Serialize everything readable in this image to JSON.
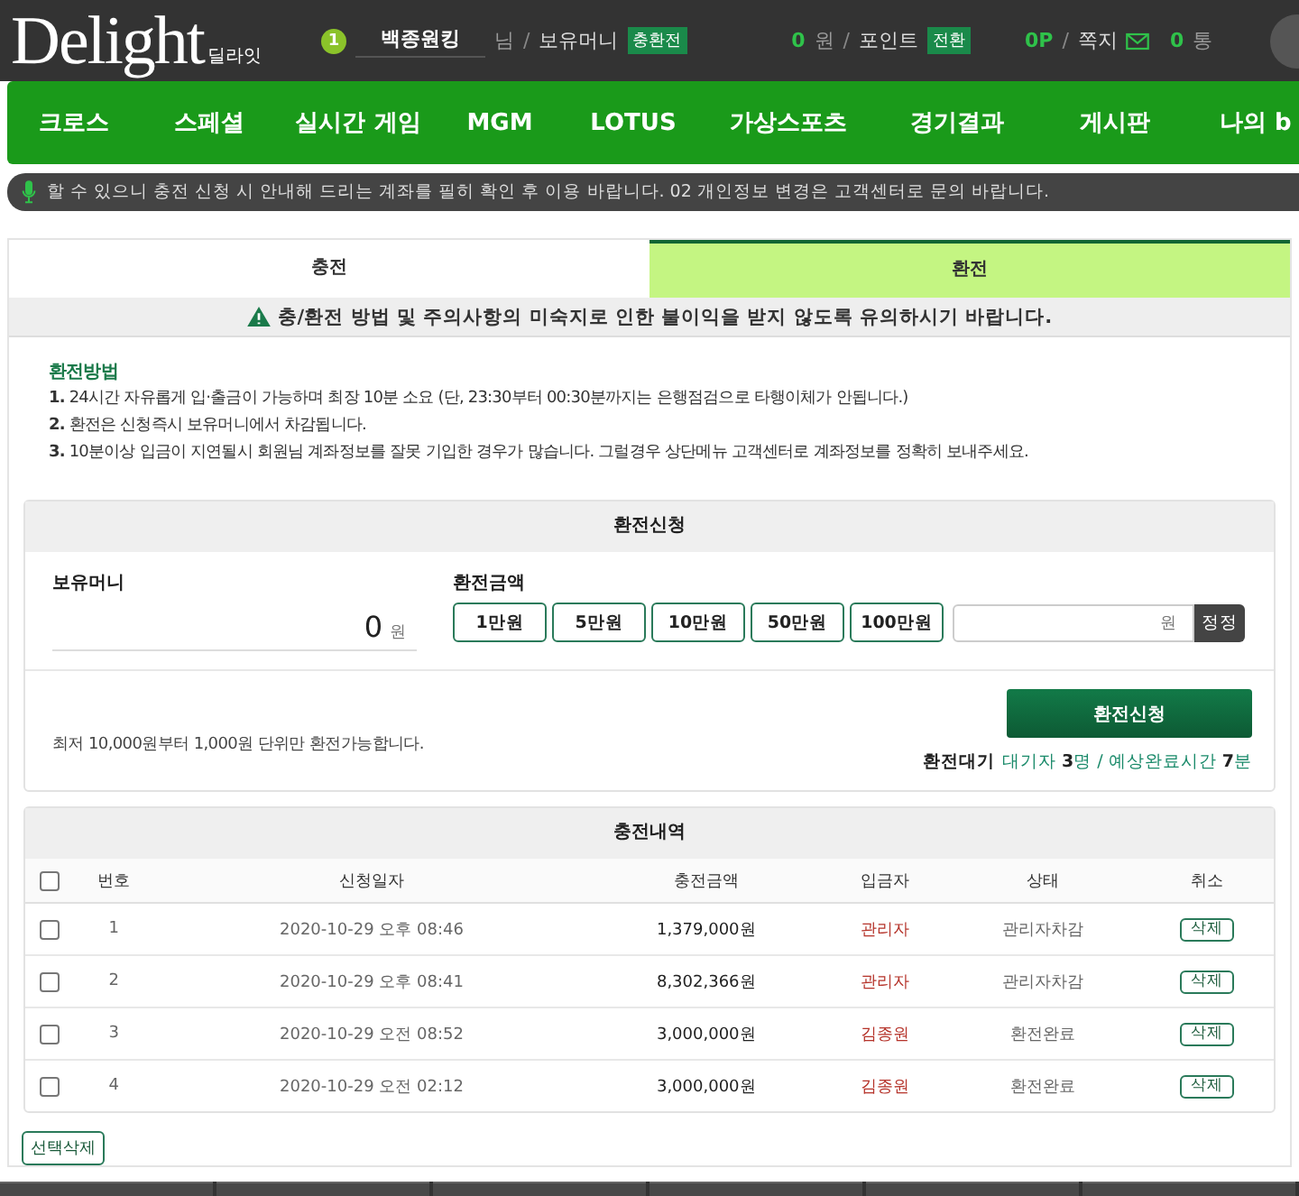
{
  "header": {
    "logo": "Delight",
    "logo_sub": "딜라잇",
    "level": "1",
    "username": "백종원킹",
    "honorific": "님",
    "money_label": "보유머니",
    "money_badge": "충환전",
    "money_value": "0",
    "money_unit": "원",
    "point_label": "포인트",
    "point_badge": "전환",
    "point_value": "0P",
    "message_label": "쪽지",
    "message_count": "0",
    "message_unit": "통",
    "separators": [
      "/",
      "/",
      "/"
    ]
  },
  "nav": [
    "크로스",
    "스페셜",
    "실시간 게임",
    "MGM",
    "LOTUS",
    "가상스포츠",
    "경기결과",
    "게시판",
    "나의 b"
  ],
  "notice": "할 수 있으니 충전 신청 시 안내해 드리는 계좌를 필히 확인 후 이용 바랍니다. 02 개인정보 변경은 고객센터로 문의 바랍니다.",
  "tabs": [
    {
      "label": "충전",
      "selected": false
    },
    {
      "label": "환전",
      "selected": true
    }
  ],
  "warning": "충/환전 방법 및 주의사항의 미숙지로 인한 불이익을 받지 않도록 유의하시기 바랍니다.",
  "method": {
    "title": "환전방법",
    "items": [
      {
        "num": "1.",
        "text": "24시간 자유롭게 입·출금이 가능하며 최장 10분 소요 (단, 23:30부터 00:30분까지는 은행점검으로 타행이체가 안됩니다.)"
      },
      {
        "num": "2.",
        "text": "환전은 신청즉시 보유머니에서 차감됩니다."
      },
      {
        "num": "3.",
        "text": "10분이상 입금이 지연될시 회원님 계좌정보를 잘못 기입한 경우가 많습니다. 그럴경우 상단메뉴 고객센터로 계좌정보를 정확히 보내주세요."
      }
    ]
  },
  "apply": {
    "title": "환전신청",
    "holding_label": "보유머니",
    "holding_value": "0",
    "holding_unit": "원",
    "amount_label": "환전금액",
    "quick_amounts": [
      "1만원",
      "5만원",
      "10만원",
      "50만원",
      "100만원"
    ],
    "amount_unit": "원",
    "reset": "정정",
    "note": "최저 10,000원부터 1,000원 단위만 환전가능합니다.",
    "submit": "환전신청",
    "wait_label": "환전대기",
    "wait_detail": "대기자 **3**명 / 예상완료시간 **7**분"
  },
  "history": {
    "title": "충전내역",
    "all_checked": false,
    "columns": [
      "번호",
      "신청일자",
      "충전금액",
      "입금자",
      "상태",
      "취소"
    ],
    "rows": [
      {
        "checked": false,
        "no": "1",
        "date": "2020-10-29 오후 08:46",
        "amount": "1,379,000원",
        "depositor": "관리자",
        "status": "관리자차감",
        "action": "삭제"
      },
      {
        "checked": false,
        "no": "2",
        "date": "2020-10-29 오후 08:41",
        "amount": "8,302,366원",
        "depositor": "관리자",
        "status": "관리자차감",
        "action": "삭제"
      },
      {
        "checked": false,
        "no": "3",
        "date": "2020-10-29 오전 08:52",
        "amount": "3,000,000원",
        "depositor": "김종원",
        "status": "환전완료",
        "action": "삭제"
      },
      {
        "checked": false,
        "no": "4",
        "date": "2020-10-29 오전 02:12",
        "amount": "3,000,000원",
        "depositor": "김종원",
        "status": "환전완료",
        "action": "삭제"
      }
    ],
    "delete_selected": "선택삭제"
  }
}
